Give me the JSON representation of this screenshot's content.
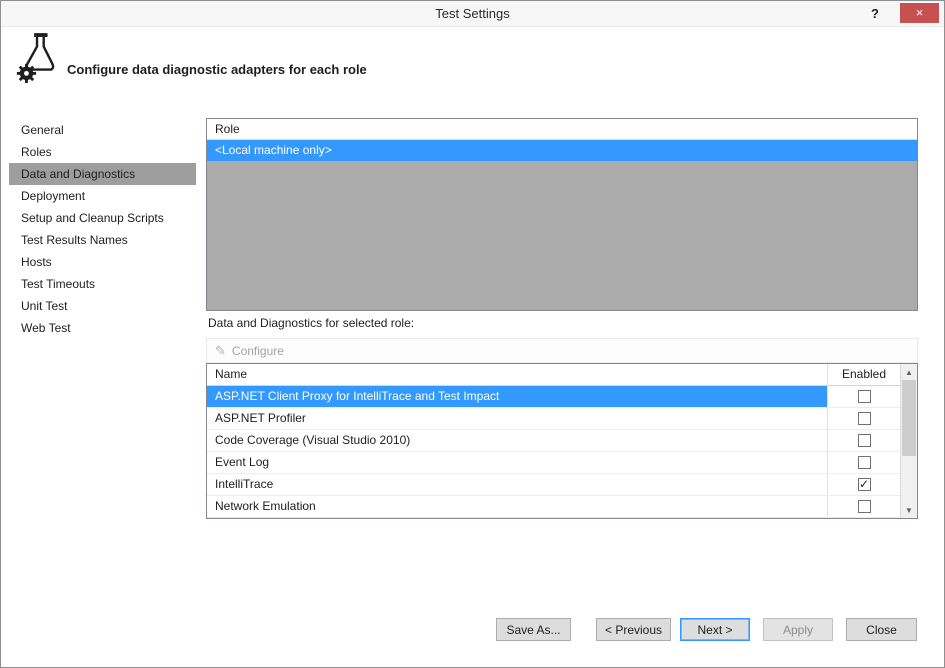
{
  "window": {
    "title": "Test Settings",
    "help_label": "?",
    "close_label": "×"
  },
  "header": {
    "description": "Configure data diagnostic adapters for each role"
  },
  "sidebar": {
    "items": [
      {
        "label": "General",
        "selected": false
      },
      {
        "label": "Roles",
        "selected": false
      },
      {
        "label": "Data and Diagnostics",
        "selected": true
      },
      {
        "label": "Deployment",
        "selected": false
      },
      {
        "label": "Setup and Cleanup Scripts",
        "selected": false
      },
      {
        "label": "Test Results Names",
        "selected": false
      },
      {
        "label": "Hosts",
        "selected": false
      },
      {
        "label": "Test Timeouts",
        "selected": false
      },
      {
        "label": "Unit Test",
        "selected": false
      },
      {
        "label": "Web Test",
        "selected": false
      }
    ]
  },
  "roles_panel": {
    "column_header": "Role",
    "rows": [
      {
        "label": "<Local machine only>",
        "selected": true
      }
    ]
  },
  "diagnostics_panel": {
    "label": "Data and Diagnostics for selected role:",
    "toolbar": {
      "configure_label": "Configure"
    },
    "columns": {
      "name": "Name",
      "enabled": "Enabled"
    },
    "rows": [
      {
        "name": "ASP.NET Client Proxy for IntelliTrace and Test Impact",
        "enabled": false,
        "selected": true
      },
      {
        "name": "ASP.NET Profiler",
        "enabled": false,
        "selected": false
      },
      {
        "name": "Code Coverage (Visual Studio 2010)",
        "enabled": false,
        "selected": false
      },
      {
        "name": "Event Log",
        "enabled": false,
        "selected": false
      },
      {
        "name": "IntelliTrace",
        "enabled": true,
        "selected": false
      },
      {
        "name": "Network Emulation",
        "enabled": false,
        "selected": false
      }
    ]
  },
  "footer": {
    "save_as": "Save As...",
    "previous": "< Previous",
    "next": "Next >",
    "apply": "Apply",
    "close": "Close"
  },
  "icons": {
    "configure": "✎",
    "scroll_up": "▲",
    "scroll_down": "▼",
    "check_glyph": "✓"
  },
  "colors": {
    "selection_blue": "#3399ff",
    "sidebar_selected_gray": "#9e9e9e",
    "close_button_red": "#c75050",
    "list_fill_gray": "#ababab"
  }
}
